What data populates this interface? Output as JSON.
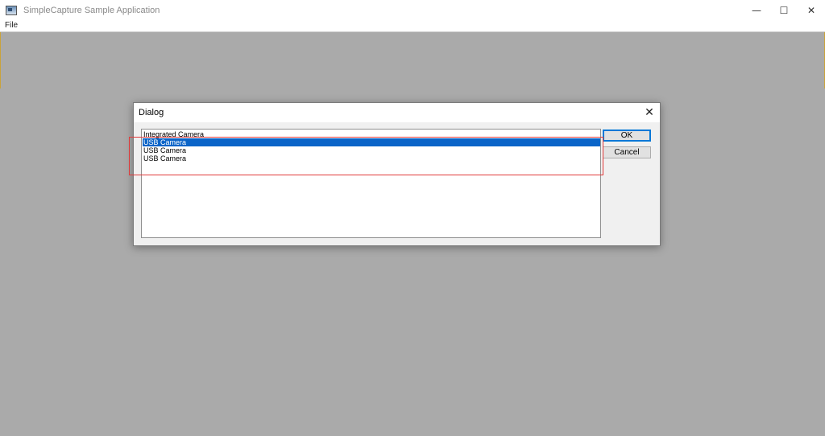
{
  "window": {
    "title": "SimpleCapture Sample Application",
    "caption_buttons": [
      "—",
      "☐",
      "✕"
    ]
  },
  "menu": {
    "items": [
      "File"
    ]
  },
  "dialog": {
    "title": "Dialog",
    "close_glyph": "✕",
    "cameras": [
      {
        "label": "Integrated Camera",
        "selected": false
      },
      {
        "label": "USB Camera",
        "selected": true
      },
      {
        "label": "USB Camera",
        "selected": false
      },
      {
        "label": "USB Camera",
        "selected": false
      }
    ],
    "ok_label": "OK",
    "cancel_label": "Cancel"
  },
  "colors": {
    "selection": "#0a64c8",
    "annotation": "#e03a3a",
    "background": "#aaaaaa"
  }
}
